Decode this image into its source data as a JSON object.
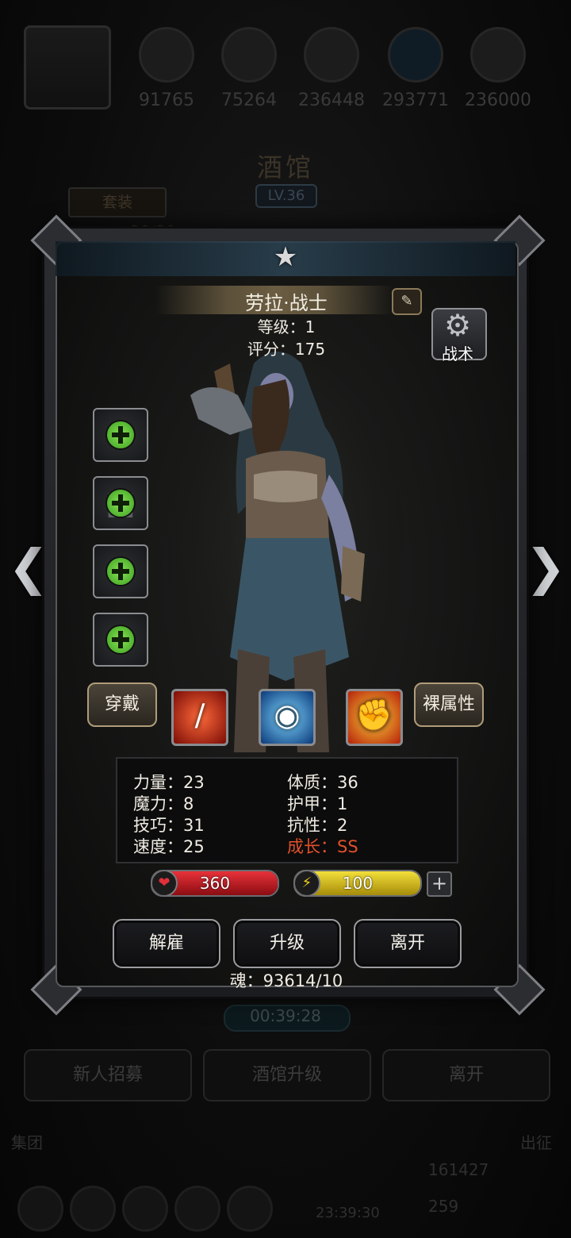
{
  "background": {
    "resources": [
      {
        "icon": "resource-1-icon",
        "value": "91765"
      },
      {
        "icon": "resource-2-icon",
        "value": "75264"
      },
      {
        "icon": "resource-3-icon",
        "value": "236448"
      },
      {
        "icon": "resource-4-icon",
        "value": "293771"
      },
      {
        "icon": "resource-5-icon",
        "value": "236000"
      }
    ],
    "title": "酒馆",
    "level": "LV.36",
    "set_button": "套装",
    "count_partial": "30/30",
    "soul_partial": "魂：93614",
    "timer": "00:39:28",
    "buttons": [
      "新人招募",
      "酒馆升级",
      "离开"
    ],
    "left_footer": "集团",
    "right_footer": "出征",
    "gold": "161427",
    "dock_timer": "23:39:30",
    "gem_partial": "259"
  },
  "hero": {
    "name": "劳拉·战士",
    "level_line": "等级：1",
    "score_line": "评分：175",
    "tactic_label": "战术"
  },
  "actions": {
    "wear": "穿戴",
    "naked_attr": "裸属性"
  },
  "stats": {
    "left": [
      "力量：23",
      "魔力：8",
      "技巧：31",
      "速度：25"
    ],
    "right": [
      "体质：36",
      "护甲：1",
      "抗性：2",
      "成长：SS"
    ],
    "highlight_color": "#e2502a"
  },
  "bars": {
    "hp": "360",
    "energy": "100",
    "hp_color": "#c4161c",
    "energy_color": "#d9c11a"
  },
  "buttons": {
    "dismiss": "解雇",
    "upgrade": "升级",
    "leave": "离开"
  },
  "soul": "魂：93614/10"
}
